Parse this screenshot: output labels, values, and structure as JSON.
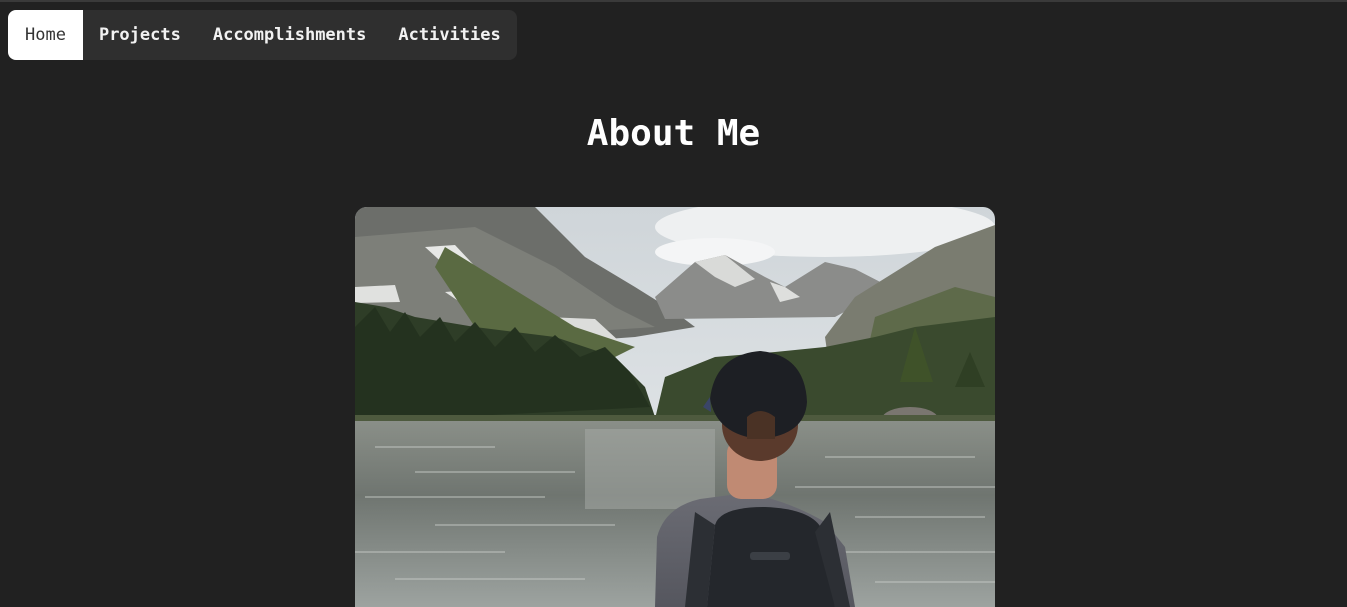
{
  "nav": {
    "items": [
      {
        "label": "Home",
        "active": true
      },
      {
        "label": "Projects",
        "active": false
      },
      {
        "label": "Accomplishments",
        "active": false
      },
      {
        "label": "Activities",
        "active": false
      }
    ]
  },
  "main": {
    "title": "About Me",
    "photo": {
      "subject": "person-wearing-cap-and-backpack-facing-mountain-lake"
    }
  },
  "colors": {
    "background": "#212121",
    "nav_bg": "#2f2f2f",
    "nav_active_bg": "#ffffff",
    "text": "#ffffff"
  }
}
